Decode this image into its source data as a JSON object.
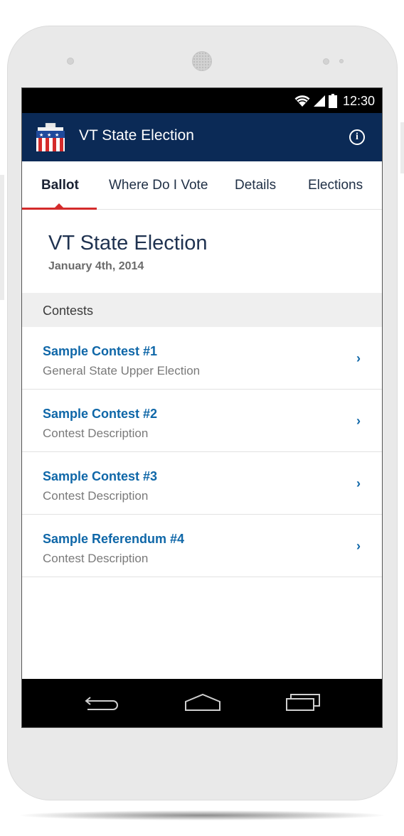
{
  "status_bar": {
    "time": "12:30",
    "icons": [
      "wifi-icon",
      "signal-icon",
      "battery-icon"
    ]
  },
  "app_bar": {
    "title": "VT State Election",
    "logo_icon": "ballot-box-icon",
    "info_symbol": "i"
  },
  "tabs": [
    {
      "label": "Ballot",
      "active": true
    },
    {
      "label": "Where Do I Vote",
      "active": false
    },
    {
      "label": "Details",
      "active": false
    },
    {
      "label": "Elections",
      "active": false
    }
  ],
  "election": {
    "title": "VT State Election",
    "date": "January 4th, 2014"
  },
  "contests_section": {
    "title": "Contests",
    "items": [
      {
        "title": "Sample Contest #1",
        "description": "General State Upper Election",
        "chevron": "›"
      },
      {
        "title": "Sample Contest #2",
        "description": "Contest Description",
        "chevron": "›"
      },
      {
        "title": "Sample Contest #3",
        "description": "Contest Description",
        "chevron": "›"
      },
      {
        "title": "Sample Referendum #4",
        "description": "Contest Description",
        "chevron": "›"
      }
    ]
  },
  "nav_bar": {
    "buttons": [
      "back-icon",
      "home-icon",
      "recent-apps-icon"
    ]
  },
  "colors": {
    "app_bar": "#0b2a56",
    "accent_red": "#d42b2b",
    "link_blue": "#0f67a8",
    "section_bg": "#efefef"
  }
}
